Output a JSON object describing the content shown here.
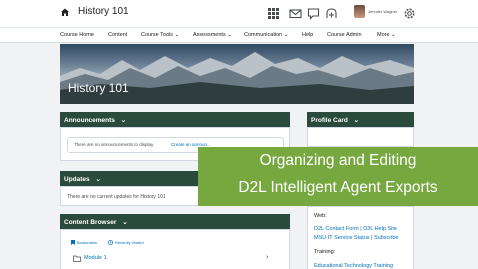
{
  "header": {
    "course_title": "History 101",
    "user_name": "Jennifer Wagner"
  },
  "nav": {
    "items": [
      {
        "label": "Course Home"
      },
      {
        "label": "Content"
      },
      {
        "label": "Course Tools ⌄"
      },
      {
        "label": "Assessments ⌄"
      },
      {
        "label": "Communication ⌄"
      },
      {
        "label": "Help"
      },
      {
        "label": "Course Admin"
      },
      {
        "label": "More ⌄"
      }
    ]
  },
  "banner": {
    "title": "History 101"
  },
  "announcements": {
    "heading": "Announcements",
    "empty_text": "There are no announcements to display.",
    "create_link": "Create an announ..."
  },
  "updates": {
    "heading": "Updates",
    "empty_text": "There are no current updates for History 101"
  },
  "content_browser": {
    "heading": "Content Browser",
    "bookmarks": "Bookmarks",
    "recently_visited": "Recently Visited",
    "module": "Module 1"
  },
  "profile_card": {
    "heading": "Profile Card"
  },
  "sidebar": {
    "web_label": "Web:",
    "links_line1": "D2L Contact Form | D3L Help Site",
    "links_line2": "MSU IT Service Status | Subscribe",
    "training_label": "Training:",
    "training_link": "Educational Technology Training"
  },
  "overlay": {
    "line1": "Organizing and Editing",
    "line2": "D2L Intelligent Agent Exports"
  },
  "colors": {
    "widget_header": "#2b4a3e",
    "overlay_green": "#77a840",
    "link_blue": "#006fbf"
  }
}
